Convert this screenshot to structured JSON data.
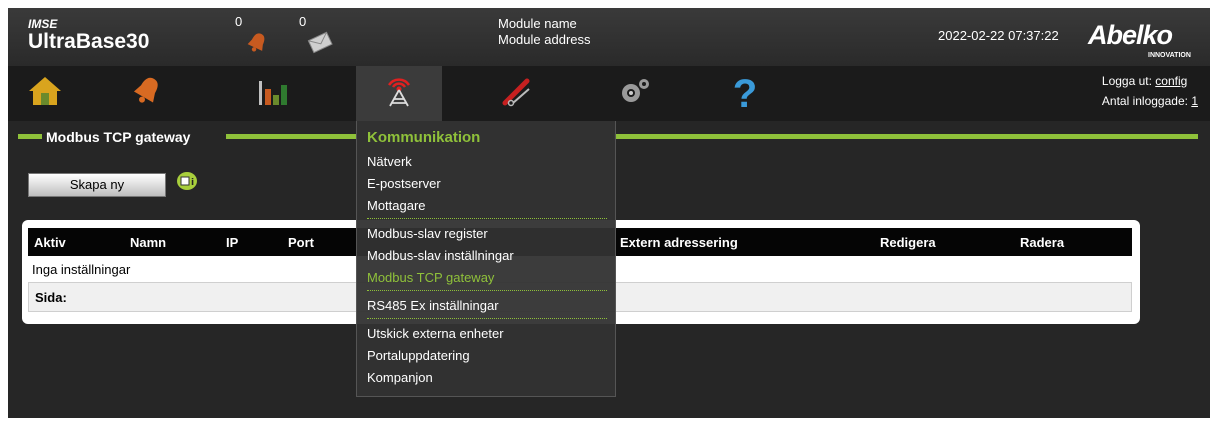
{
  "header": {
    "brand_top": "IMSE",
    "brand_name": "UltraBase30",
    "alarm_count": "0",
    "message_count": "0",
    "module_name": "Module name",
    "module_address": "Module address",
    "datetime": "2022-02-22 07:37:22",
    "logo_main": "Abelko",
    "logo_sub": "INNOVATION"
  },
  "nav": {
    "items": [
      {
        "icon": "home-icon"
      },
      {
        "icon": "bell-icon"
      },
      {
        "icon": "bar-chart-icon"
      },
      {
        "icon": "antenna-icon",
        "active": true
      },
      {
        "icon": "tools-icon"
      },
      {
        "icon": "gears-icon"
      },
      {
        "icon": "help-icon"
      }
    ],
    "logout_label": "Logga ut:",
    "logout_user": "config",
    "logged_in_label": "Antal inloggade:",
    "logged_in_count": "1"
  },
  "section": {
    "title": "Modbus TCP gateway",
    "create_button": "Skapa ny",
    "info_icon": "info-icon"
  },
  "table": {
    "headers": [
      "Aktiv",
      "Namn",
      "IP",
      "Port",
      "Extern adressering",
      "Redigera",
      "Radera"
    ],
    "empty_text": "Inga inställningar",
    "page_label": "Sida:"
  },
  "dropdown": {
    "heading": "Kommunikation",
    "items": [
      "Nätverk",
      "E-postserver",
      "Mottagare",
      "Modbus-slav register",
      "Modbus-slav inställningar",
      "Modbus TCP gateway",
      "RS485 Ex inställningar",
      "Utskick externa enheter",
      "Portaluppdatering",
      "Kompanjon"
    ],
    "active_item": "Modbus TCP gateway"
  },
  "colors": {
    "accent": "#8fc13a",
    "header_bg": "#333333",
    "nav_bg": "#1b1b1b",
    "content_bg": "#262626"
  }
}
